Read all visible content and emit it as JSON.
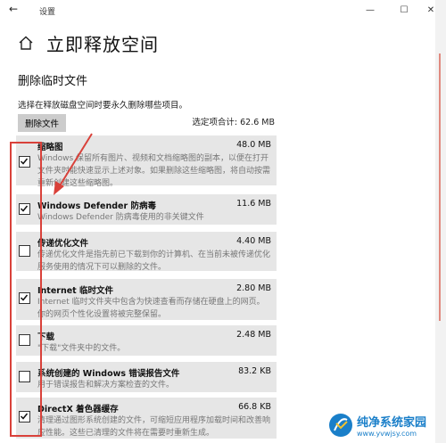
{
  "window": {
    "title": "设置",
    "back": "←",
    "minimize": "—",
    "maximize": "☐",
    "close": "✕"
  },
  "header": {
    "title": "立即释放空间"
  },
  "section": {
    "title": "删除临时文件",
    "description": "选择在释放磁盘空间时要永久删除哪些项目。",
    "delete_button": "删除文件",
    "total": "选定项合计: 62.6 MB"
  },
  "items": [
    {
      "name": "缩略图",
      "size": "48.0 MB",
      "checked": true,
      "desc": "Windows 保留所有图片、视频和文档缩略图的副本，以便在打开文件夹时能快速显示上述对象。如果删除这些缩略图，将自动按需重新创建这些缩略图。"
    },
    {
      "name": "Windows Defender 防病毒",
      "size": "11.6 MB",
      "checked": true,
      "desc": "Windows Defender 防病毒使用的非关键文件"
    },
    {
      "name": "传递优化文件",
      "size": "4.40 MB",
      "checked": false,
      "desc": "传递优化文件是指先前已下载到你的计算机、在当前未被传递优化服务使用的情况下可以删除的文件。"
    },
    {
      "name": "Internet 临时文件",
      "size": "2.80 MB",
      "checked": true,
      "desc": "Internet 临时文件夹中包含为快速查看而存储在硬盘上的网页。你的网页个性化设置将被完整保留。"
    },
    {
      "name": "下载",
      "size": "2.48 MB",
      "checked": false,
      "desc": "\"下载\"文件夹中的文件。"
    },
    {
      "name": "系统创建的 Windows 错误报告文件",
      "size": "83.2 KB",
      "checked": false,
      "desc": "用于错误报告和解决方案检查的文件。"
    },
    {
      "name": "DirectX 着色器缓存",
      "size": "66.8 KB",
      "checked": true,
      "desc": "清理通过图形系统创建的文件，可缩短应用程序加载时间和改善响应性能。这些已清理的文件将在需要时重新生成。"
    }
  ],
  "watermark": {
    "main": "纯净系统家园",
    "url": "www.yvwjsy.com"
  },
  "colors": {
    "annotation": "#d9413a",
    "item_bg": "#e6e6e6",
    "watermark": "#1a7fc9"
  }
}
